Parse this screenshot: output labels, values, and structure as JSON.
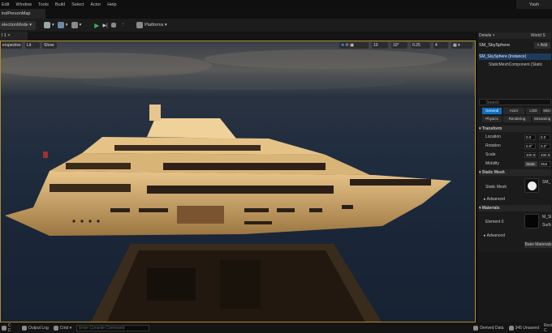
{
  "menu": [
    "Edit",
    "Window",
    "Tools",
    "Build",
    "Select",
    "Actor",
    "Help"
  ],
  "user": "Yash",
  "map_tab": "irstPersonMap",
  "toolbar": {
    "mode": "electionMode",
    "platforms": "Platforms"
  },
  "viewport_tab": "l 1",
  "viewport": {
    "perspective": "erspective",
    "lit": "Lit",
    "show": "Show",
    "snap_values": [
      "10",
      "10°",
      "0.25",
      "4"
    ]
  },
  "details": {
    "tab": "Details",
    "tab2": "World S",
    "actor": "SM_SkySphere",
    "add": "+ Add",
    "instance": "SM_SkySphere (Instance)",
    "component": "StaticMeshComponent (Static",
    "search": "Search",
    "categories": [
      "General",
      "Actor",
      "LOD",
      "Misc",
      "Physics",
      "Rendering",
      "Streaming"
    ],
    "transform": "Transform",
    "location": "Location",
    "rotation": "Rotation",
    "scale": "Scale",
    "loc_vals": [
      "0.0",
      "0.0"
    ],
    "rot_vals": [
      "0.0°",
      "0.0°"
    ],
    "scale_vals": [
      "400.0",
      "400.0"
    ],
    "mobility": "Mobility",
    "mobility_val": "Static",
    "mobility_val2": "Stat",
    "static_mesh_section": "Static Mesh",
    "static_mesh": "Static Mesh",
    "static_mesh_val": "SM_",
    "advanced": "Advanced",
    "materials": "Materials",
    "element0": "Element 0",
    "element0_val": "M_Sk",
    "element0_val2": "Surfac",
    "advanced2": "Advanced",
    "bake": "Bake Materials"
  },
  "status": {
    "content_drawer": "Content Drawer",
    "output_log": "Output Log",
    "cmd": "Cmd",
    "cmd_placeholder": "Enter Console Command",
    "derived": "Derived Data",
    "unsaved": "345 Unsaved",
    "rc": "Revision C"
  },
  "colors": {
    "accent": "#0e70c0",
    "play": "#37b24d",
    "viewport_border": "#b08a2e"
  }
}
